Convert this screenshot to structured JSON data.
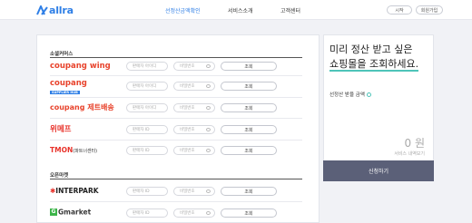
{
  "header": {
    "logo_text": "allra",
    "nav": [
      {
        "label": "선정산금액확인",
        "active": true
      },
      {
        "label": "서비스소개",
        "active": false
      },
      {
        "label": "고객센터",
        "active": false
      }
    ],
    "login_label": "시작",
    "signup_label": "회원가입"
  },
  "social": {
    "title": "소셜커머스",
    "rows": [
      {
        "brand": "coupang wing",
        "brand_color": "#e8432c",
        "id_placeholder": "판매자 아이디",
        "pw_placeholder": "비밀번호",
        "button": "조회"
      },
      {
        "brand": "coupang",
        "brand_sub": "SUPPLIER HUB",
        "brand_color": "#e8432c",
        "id_placeholder": "판매자 아이디",
        "pw_placeholder": "비밀번호",
        "button": "조회"
      },
      {
        "brand": "coupang 제트배송",
        "brand_color": "#e8432c",
        "id_placeholder": "판매자 아이디",
        "pw_placeholder": "비밀번호",
        "button": "조회"
      },
      {
        "brand": "위메프",
        "brand_color": "#e8322a",
        "id_placeholder": "판매자 ID",
        "pw_placeholder": "비밀번호",
        "button": "조회"
      },
      {
        "brand": "TMON",
        "brand_suffix": "(파트너센터)",
        "brand_color": "#e8322a",
        "id_placeholder": "판매자 ID",
        "pw_placeholder": "비밀번호",
        "button": "조회"
      }
    ]
  },
  "openmarket": {
    "title": "오픈마켓",
    "rows": [
      {
        "brand": "INTERPARK",
        "brand_color": "#222222",
        "id_placeholder": "판매자 ID",
        "pw_placeholder": "비밀번호",
        "button": "조회"
      },
      {
        "brand": "Gmarket",
        "brand_color": "#3a3a3a",
        "id_placeholder": "판매자 ID",
        "pw_placeholder": "비밀번호",
        "button": "조회"
      }
    ]
  },
  "summary": {
    "headline_line1": "미리 정산 받고 싶은",
    "headline_line2": "쇼핑몰을 조회하세요.",
    "amount_label": "선정산 받을 금액",
    "amount": "0 원",
    "note": "서비스 내역보기",
    "cta": "신청하기"
  },
  "colors": {
    "accent": "#2f7fe6",
    "teal": "#4ec4b9",
    "cta_bg": "#5b6078"
  }
}
